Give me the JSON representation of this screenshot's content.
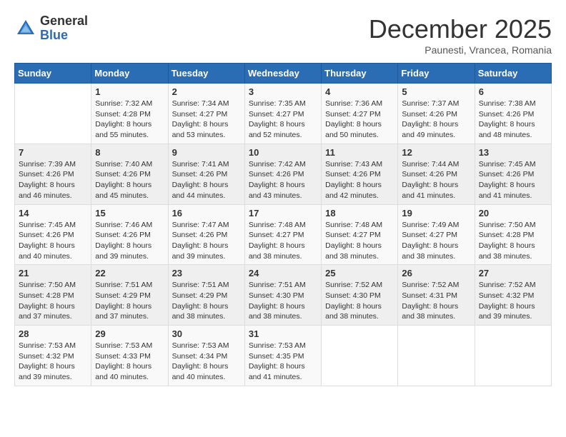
{
  "header": {
    "logo_general": "General",
    "logo_blue": "Blue",
    "month_title": "December 2025",
    "location": "Paunesti, Vrancea, Romania"
  },
  "days_of_week": [
    "Sunday",
    "Monday",
    "Tuesday",
    "Wednesday",
    "Thursday",
    "Friday",
    "Saturday"
  ],
  "weeks": [
    [
      {
        "day": "",
        "info": ""
      },
      {
        "day": "1",
        "info": "Sunrise: 7:32 AM\nSunset: 4:28 PM\nDaylight: 8 hours\nand 55 minutes."
      },
      {
        "day": "2",
        "info": "Sunrise: 7:34 AM\nSunset: 4:27 PM\nDaylight: 8 hours\nand 53 minutes."
      },
      {
        "day": "3",
        "info": "Sunrise: 7:35 AM\nSunset: 4:27 PM\nDaylight: 8 hours\nand 52 minutes."
      },
      {
        "day": "4",
        "info": "Sunrise: 7:36 AM\nSunset: 4:27 PM\nDaylight: 8 hours\nand 50 minutes."
      },
      {
        "day": "5",
        "info": "Sunrise: 7:37 AM\nSunset: 4:26 PM\nDaylight: 8 hours\nand 49 minutes."
      },
      {
        "day": "6",
        "info": "Sunrise: 7:38 AM\nSunset: 4:26 PM\nDaylight: 8 hours\nand 48 minutes."
      }
    ],
    [
      {
        "day": "7",
        "info": "Sunrise: 7:39 AM\nSunset: 4:26 PM\nDaylight: 8 hours\nand 46 minutes."
      },
      {
        "day": "8",
        "info": "Sunrise: 7:40 AM\nSunset: 4:26 PM\nDaylight: 8 hours\nand 45 minutes."
      },
      {
        "day": "9",
        "info": "Sunrise: 7:41 AM\nSunset: 4:26 PM\nDaylight: 8 hours\nand 44 minutes."
      },
      {
        "day": "10",
        "info": "Sunrise: 7:42 AM\nSunset: 4:26 PM\nDaylight: 8 hours\nand 43 minutes."
      },
      {
        "day": "11",
        "info": "Sunrise: 7:43 AM\nSunset: 4:26 PM\nDaylight: 8 hours\nand 42 minutes."
      },
      {
        "day": "12",
        "info": "Sunrise: 7:44 AM\nSunset: 4:26 PM\nDaylight: 8 hours\nand 41 minutes."
      },
      {
        "day": "13",
        "info": "Sunrise: 7:45 AM\nSunset: 4:26 PM\nDaylight: 8 hours\nand 41 minutes."
      }
    ],
    [
      {
        "day": "14",
        "info": "Sunrise: 7:45 AM\nSunset: 4:26 PM\nDaylight: 8 hours\nand 40 minutes."
      },
      {
        "day": "15",
        "info": "Sunrise: 7:46 AM\nSunset: 4:26 PM\nDaylight: 8 hours\nand 39 minutes."
      },
      {
        "day": "16",
        "info": "Sunrise: 7:47 AM\nSunset: 4:26 PM\nDaylight: 8 hours\nand 39 minutes."
      },
      {
        "day": "17",
        "info": "Sunrise: 7:48 AM\nSunset: 4:27 PM\nDaylight: 8 hours\nand 38 minutes."
      },
      {
        "day": "18",
        "info": "Sunrise: 7:48 AM\nSunset: 4:27 PM\nDaylight: 8 hours\nand 38 minutes."
      },
      {
        "day": "19",
        "info": "Sunrise: 7:49 AM\nSunset: 4:27 PM\nDaylight: 8 hours\nand 38 minutes."
      },
      {
        "day": "20",
        "info": "Sunrise: 7:50 AM\nSunset: 4:28 PM\nDaylight: 8 hours\nand 38 minutes."
      }
    ],
    [
      {
        "day": "21",
        "info": "Sunrise: 7:50 AM\nSunset: 4:28 PM\nDaylight: 8 hours\nand 37 minutes."
      },
      {
        "day": "22",
        "info": "Sunrise: 7:51 AM\nSunset: 4:29 PM\nDaylight: 8 hours\nand 37 minutes."
      },
      {
        "day": "23",
        "info": "Sunrise: 7:51 AM\nSunset: 4:29 PM\nDaylight: 8 hours\nand 38 minutes."
      },
      {
        "day": "24",
        "info": "Sunrise: 7:51 AM\nSunset: 4:30 PM\nDaylight: 8 hours\nand 38 minutes."
      },
      {
        "day": "25",
        "info": "Sunrise: 7:52 AM\nSunset: 4:30 PM\nDaylight: 8 hours\nand 38 minutes."
      },
      {
        "day": "26",
        "info": "Sunrise: 7:52 AM\nSunset: 4:31 PM\nDaylight: 8 hours\nand 38 minutes."
      },
      {
        "day": "27",
        "info": "Sunrise: 7:52 AM\nSunset: 4:32 PM\nDaylight: 8 hours\nand 39 minutes."
      }
    ],
    [
      {
        "day": "28",
        "info": "Sunrise: 7:53 AM\nSunset: 4:32 PM\nDaylight: 8 hours\nand 39 minutes."
      },
      {
        "day": "29",
        "info": "Sunrise: 7:53 AM\nSunset: 4:33 PM\nDaylight: 8 hours\nand 40 minutes."
      },
      {
        "day": "30",
        "info": "Sunrise: 7:53 AM\nSunset: 4:34 PM\nDaylight: 8 hours\nand 40 minutes."
      },
      {
        "day": "31",
        "info": "Sunrise: 7:53 AM\nSunset: 4:35 PM\nDaylight: 8 hours\nand 41 minutes."
      },
      {
        "day": "",
        "info": ""
      },
      {
        "day": "",
        "info": ""
      },
      {
        "day": "",
        "info": ""
      }
    ]
  ]
}
